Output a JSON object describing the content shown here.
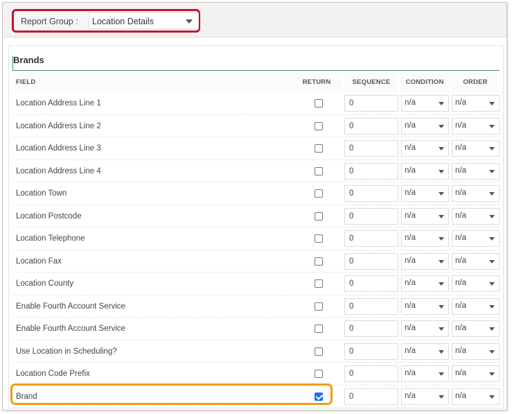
{
  "report_group": {
    "label": "Report Group :",
    "selected": "Location Details"
  },
  "section": {
    "title": "Brands"
  },
  "columns": {
    "field": "FIELD",
    "return": "RETURN",
    "sequence": "SEQUENCE",
    "condition": "CONDITION",
    "order": "ORDER"
  },
  "rows": [
    {
      "field": "Location Address Line 1",
      "return": false,
      "sequence": "0",
      "condition": "n/a",
      "order": "n/a"
    },
    {
      "field": "Location Address Line 2",
      "return": false,
      "sequence": "0",
      "condition": "n/a",
      "order": "n/a"
    },
    {
      "field": "Location Address Line 3",
      "return": false,
      "sequence": "0",
      "condition": "n/a",
      "order": "n/a"
    },
    {
      "field": "Location Address Line 4",
      "return": false,
      "sequence": "0",
      "condition": "n/a",
      "order": "n/a"
    },
    {
      "field": "Location Town",
      "return": false,
      "sequence": "0",
      "condition": "n/a",
      "order": "n/a"
    },
    {
      "field": "Location Postcode",
      "return": false,
      "sequence": "0",
      "condition": "n/a",
      "order": "n/a"
    },
    {
      "field": "Location Telephone",
      "return": false,
      "sequence": "0",
      "condition": "n/a",
      "order": "n/a"
    },
    {
      "field": "Location Fax",
      "return": false,
      "sequence": "0",
      "condition": "n/a",
      "order": "n/a"
    },
    {
      "field": "Location County",
      "return": false,
      "sequence": "0",
      "condition": "n/a",
      "order": "n/a"
    },
    {
      "field": "Enable Fourth Account Service",
      "return": false,
      "sequence": "0",
      "condition": "n/a",
      "order": "n/a"
    },
    {
      "field": "Enable Fourth Account Service",
      "return": false,
      "sequence": "0",
      "condition": "n/a",
      "order": "n/a"
    },
    {
      "field": "Use Location in Scheduling?",
      "return": false,
      "sequence": "0",
      "condition": "n/a",
      "order": "n/a"
    },
    {
      "field": "Location Code Prefix",
      "return": false,
      "sequence": "0",
      "condition": "n/a",
      "order": "n/a"
    },
    {
      "field": "Brand",
      "return": true,
      "sequence": "0",
      "condition": "n/a",
      "order": "n/a",
      "highlighted": true
    }
  ],
  "colors": {
    "report_group_highlight": "#c8102e",
    "row_highlight": "#f39c12",
    "checkbox_checked": "#1a73e8",
    "section_rule": "#3a8c8c"
  }
}
